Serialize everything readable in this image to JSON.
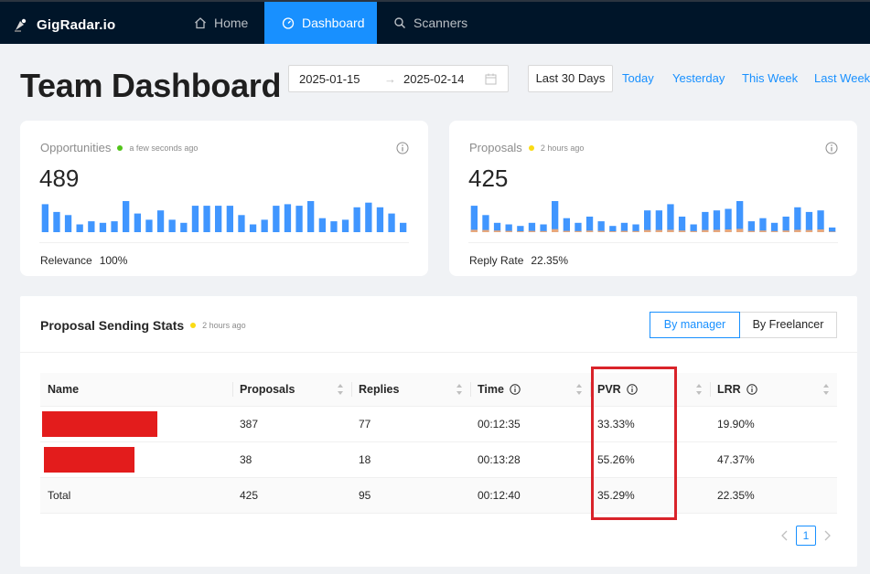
{
  "app": {
    "name": "GigRadar.io"
  },
  "nav": {
    "items": [
      {
        "label": "Home",
        "icon": "home-icon"
      },
      {
        "label": "Dashboard",
        "icon": "dashboard-icon",
        "active": true
      },
      {
        "label": "Scanners",
        "icon": "search-icon"
      }
    ]
  },
  "page": {
    "title": "Team Dashboard"
  },
  "date_range": {
    "start": "2025-01-15",
    "end": "2025-02-14",
    "arrow": "→"
  },
  "quick_ranges": {
    "selected": "Last 30 Days",
    "links": [
      "Today",
      "Yesterday",
      "This Week",
      "Last Week"
    ]
  },
  "cards": {
    "opportunities": {
      "title": "Opportunities",
      "status_color": "#52c41a",
      "updated": "a few seconds ago",
      "value": "489",
      "footer_label": "Relevance",
      "footer_value": "100%",
      "bars": [
        0.9,
        0.65,
        0.55,
        0.25,
        0.35,
        0.3,
        0.35,
        1.0,
        0.6,
        0.4,
        0.7,
        0.4,
        0.3,
        0.85,
        0.85,
        0.85,
        0.85,
        0.55,
        0.25,
        0.4,
        0.85,
        0.9,
        0.85,
        1.0,
        0.45,
        0.35,
        0.4,
        0.8,
        0.95,
        0.8,
        0.6,
        0.3
      ],
      "bar_color": "#4096ff"
    },
    "proposals": {
      "title": "Proposals",
      "status_color": "#fadb14",
      "updated": "2 hours ago",
      "value": "425",
      "footer_label": "Reply Rate",
      "footer_value": "22.35%",
      "bars": [
        0.85,
        0.55,
        0.3,
        0.25,
        0.2,
        0.3,
        0.25,
        1.0,
        0.45,
        0.3,
        0.5,
        0.35,
        0.2,
        0.3,
        0.25,
        0.7,
        0.7,
        0.9,
        0.5,
        0.25,
        0.65,
        0.7,
        0.75,
        1.0,
        0.35,
        0.45,
        0.3,
        0.5,
        0.8,
        0.65,
        0.7,
        0.15
      ],
      "reply_bars": [
        0.22,
        0.2,
        0.15,
        0.12,
        0.08,
        0.12,
        0.1,
        0.28,
        0.12,
        0.1,
        0.14,
        0.12,
        0.08,
        0.12,
        0.1,
        0.2,
        0.2,
        0.22,
        0.15,
        0.1,
        0.2,
        0.22,
        0.25,
        0.3,
        0.12,
        0.15,
        0.1,
        0.15,
        0.22,
        0.2,
        0.25,
        0.05
      ],
      "bar_color": "#4096ff",
      "reply_color": "#e8a87c"
    }
  },
  "stats": {
    "title": "Proposal Sending Stats",
    "status_color": "#fadb14",
    "updated": "2 hours ago",
    "segments": [
      "By manager",
      "By Freelancer"
    ],
    "selected_segment": "By manager",
    "columns": [
      "Name",
      "Proposals",
      "Replies",
      "Time",
      "PVR",
      "LRR"
    ],
    "rows": [
      {
        "name": "",
        "proposals": "387",
        "replies": "77",
        "time": "00:12:35",
        "pvr": "33.33%",
        "lrr": "19.90%"
      },
      {
        "name": "",
        "proposals": "38",
        "replies": "18",
        "time": "00:13:28",
        "pvr": "55.26%",
        "lrr": "47.37%"
      },
      {
        "name": "Total",
        "proposals": "425",
        "replies": "95",
        "time": "00:12:40",
        "pvr": "35.29%",
        "lrr": "22.35%"
      }
    ],
    "redaction_color": "#e31c1c",
    "highlight_color": "#d9232a"
  },
  "pagination": {
    "current": "1"
  }
}
